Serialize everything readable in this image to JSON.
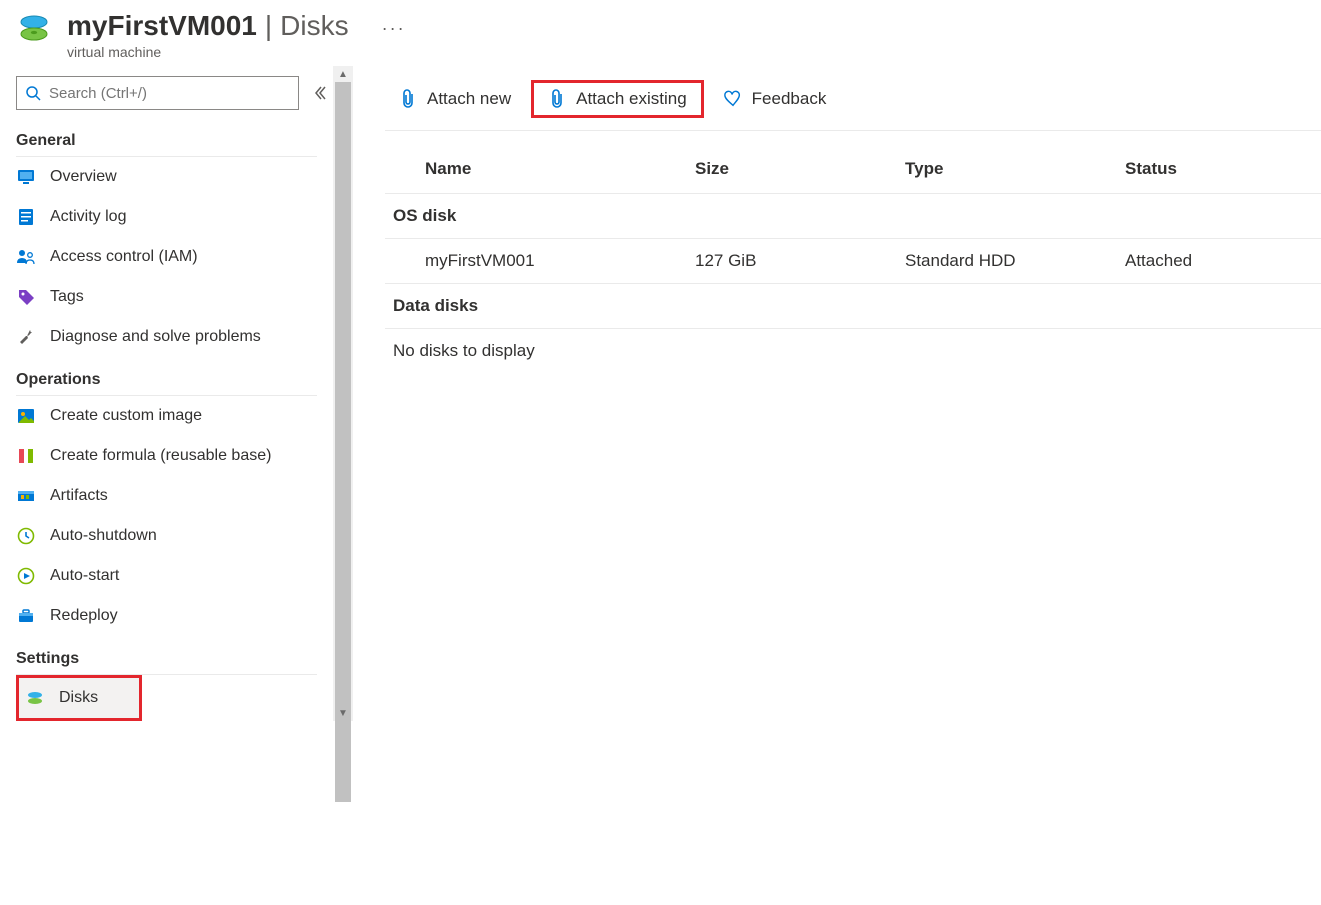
{
  "header": {
    "title": "myFirstVM001",
    "section": "Disks",
    "subtitle": "virtual machine"
  },
  "search": {
    "placeholder": "Search (Ctrl+/)"
  },
  "sidebar": {
    "sections": {
      "general": {
        "title": "General",
        "items": [
          {
            "label": "Overview"
          },
          {
            "label": "Activity log"
          },
          {
            "label": "Access control (IAM)"
          },
          {
            "label": "Tags"
          },
          {
            "label": "Diagnose and solve problems"
          }
        ]
      },
      "operations": {
        "title": "Operations",
        "items": [
          {
            "label": "Create custom image"
          },
          {
            "label": "Create formula (reusable base)"
          },
          {
            "label": "Artifacts"
          },
          {
            "label": "Auto-shutdown"
          },
          {
            "label": "Auto-start"
          },
          {
            "label": "Redeploy"
          }
        ]
      },
      "settings": {
        "title": "Settings",
        "items": [
          {
            "label": "Disks"
          }
        ]
      }
    }
  },
  "toolbar": {
    "attach_new": "Attach new",
    "attach_existing": "Attach existing",
    "feedback": "Feedback"
  },
  "table": {
    "headers": {
      "name": "Name",
      "size": "Size",
      "type": "Type",
      "status": "Status"
    },
    "os_section": "OS disk",
    "os_rows": [
      {
        "name": "myFirstVM001",
        "size": "127 GiB",
        "type": "Standard HDD",
        "status": "Attached"
      }
    ],
    "data_section": "Data disks",
    "data_empty": "No disks to display"
  }
}
